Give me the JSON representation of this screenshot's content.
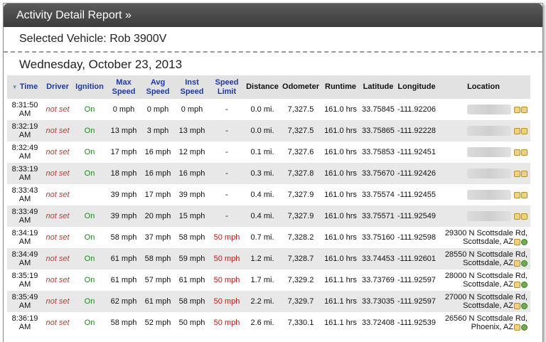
{
  "report": {
    "title": "Activity Detail Report »",
    "vehicle_label": "Selected Vehicle: Rob 3900V",
    "date_label": "Wednesday, October 23, 2013"
  },
  "columns": {
    "sort_indicator": "▼",
    "time": "Time",
    "driver": "Driver",
    "ignition": "Ignition",
    "max_speed": "Max Speed",
    "avg_speed": "Avg Speed",
    "inst_speed": "Inst Speed",
    "speed_limit": "Speed Limit",
    "distance": "Distance",
    "odometer": "Odometer",
    "runtime": "Runtime",
    "latitude": "Latitude",
    "longitude": "Longitude",
    "location": "Location"
  },
  "rows": [
    {
      "time": "8:31:50 AM",
      "driver": "not set",
      "ignition": "On",
      "max": "0 mph",
      "avg": "0 mph",
      "inst": "0 mph",
      "limit": "-",
      "dist": "0.0 mi.",
      "odo": "7,327.5",
      "run": "161.0 hrs",
      "lat": "33.75845",
      "lon": "-111.92206",
      "loc1": "",
      "loc2": ""
    },
    {
      "time": "8:32:19 AM",
      "driver": "not set",
      "ignition": "On",
      "max": "13 mph",
      "avg": "3 mph",
      "inst": "13 mph",
      "limit": "-",
      "dist": "0.0 mi.",
      "odo": "7,327.5",
      "run": "161.0 hrs",
      "lat": "33.75865",
      "lon": "-111.92228",
      "loc1": "",
      "loc2": ""
    },
    {
      "time": "8:32:49 AM",
      "driver": "not set",
      "ignition": "On",
      "max": "17 mph",
      "avg": "16 mph",
      "inst": "12 mph",
      "limit": "-",
      "dist": "0.1 mi.",
      "odo": "7,327.6",
      "run": "161.0 hrs",
      "lat": "33.75853",
      "lon": "-111.92451",
      "loc1": "",
      "loc2": ""
    },
    {
      "time": "8:33:19 AM",
      "driver": "not set",
      "ignition": "On",
      "max": "18 mph",
      "avg": "16 mph",
      "inst": "16 mph",
      "limit": "-",
      "dist": "0.3 mi.",
      "odo": "7,327.8",
      "run": "161.0 hrs",
      "lat": "33.75670",
      "lon": "-111.92426",
      "loc1": "",
      "loc2": ""
    },
    {
      "time": "8:33:43 AM",
      "driver": "not set",
      "ignition": "",
      "max": "39 mph",
      "avg": "17 mph",
      "inst": "39 mph",
      "limit": "-",
      "dist": "0.4 mi.",
      "odo": "7,327.9",
      "run": "161.0 hrs",
      "lat": "33.75574",
      "lon": "-111.92455",
      "loc1": "",
      "loc2": ""
    },
    {
      "time": "8:33:49 AM",
      "driver": "not set",
      "ignition": "On",
      "max": "39 mph",
      "avg": "20 mph",
      "inst": "15 mph",
      "limit": "-",
      "dist": "0.4 mi.",
      "odo": "7,327.9",
      "run": "161.0 hrs",
      "lat": "33.75571",
      "lon": "-111.92549",
      "loc1": "",
      "loc2": ""
    },
    {
      "time": "8:34:19 AM",
      "driver": "not set",
      "ignition": "On",
      "max": "58 mph",
      "avg": "37 mph",
      "inst": "58 mph",
      "limit": "50 mph",
      "dist": "0.7 mi.",
      "odo": "7,328.2",
      "run": "161.0 hrs",
      "lat": "33.75160",
      "lon": "-111.92598",
      "loc1": "29300 N Scottsdale Rd,",
      "loc2": "Scottsdale, AZ"
    },
    {
      "time": "8:34:49 AM",
      "driver": "not set",
      "ignition": "On",
      "max": "61 mph",
      "avg": "58 mph",
      "inst": "59 mph",
      "limit": "50 mph",
      "dist": "1.2 mi.",
      "odo": "7,328.7",
      "run": "161.0 hrs",
      "lat": "33.74453",
      "lon": "-111.92601",
      "loc1": "28550 N Scottsdale Rd,",
      "loc2": "Scottsdale, AZ"
    },
    {
      "time": "8:35:19 AM",
      "driver": "not set",
      "ignition": "On",
      "max": "61 mph",
      "avg": "57 mph",
      "inst": "61 mph",
      "limit": "50 mph",
      "dist": "1.7 mi.",
      "odo": "7,329.2",
      "run": "161.1 hrs",
      "lat": "33.73769",
      "lon": "-111.92597",
      "loc1": "28000 N Scottsdale Rd,",
      "loc2": "Scottsdale, AZ"
    },
    {
      "time": "8:35:49 AM",
      "driver": "not set",
      "ignition": "On",
      "max": "62 mph",
      "avg": "61 mph",
      "inst": "58 mph",
      "limit": "50 mph",
      "dist": "2.2 mi.",
      "odo": "7,329.7",
      "run": "161.1 hrs",
      "lat": "33.73035",
      "lon": "-111.92597",
      "loc1": "27000 N Scottsdale Rd,",
      "loc2": "Scottsdale, AZ"
    },
    {
      "time": "8:36:19 AM",
      "driver": "not set",
      "ignition": "On",
      "max": "58 mph",
      "avg": "52 mph",
      "inst": "50 mph",
      "limit": "50 mph",
      "dist": "2.6 mi.",
      "odo": "7,330.1",
      "run": "161.1 hrs",
      "lat": "33.72408",
      "lon": "-111.92539",
      "loc1": "26560 N Scottsdale Rd,",
      "loc2": "Phoenix, AZ"
    }
  ]
}
